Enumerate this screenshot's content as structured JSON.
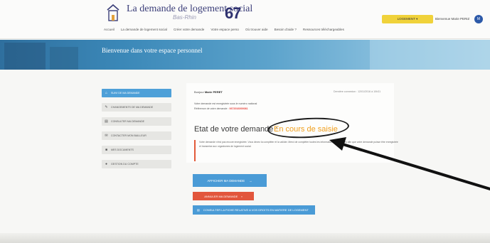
{
  "header": {
    "site_title": "La demande de logement social",
    "site_subtitle": "Bas-Rhin",
    "site_number": "67",
    "nav": [
      "Accueil",
      "La demande de logement social",
      "Créer votre demande",
      "Votre espace perso",
      "Où trouver aide",
      "Besoin d'aide ?",
      "Ressources téléchargeables"
    ],
    "account_button": "LOGEMENT ▾",
    "user_name": "Bienvenue Marie PERIZ",
    "avatar_initial": "M"
  },
  "banner": {
    "title": "Bienvenue dans votre espace personnel"
  },
  "sidebar": {
    "items": [
      {
        "label": "SUIVI DE MA DEMANDE",
        "icon": "home-icon"
      },
      {
        "label": "CHANGEMENTS DE MA DEMANDE",
        "icon": "edit-icon"
      },
      {
        "label": "CONSULTER MA DEMANDE",
        "icon": "document-icon"
      },
      {
        "label": "CONTACTER MON BAILLEUR",
        "icon": "mail-icon"
      },
      {
        "label": "MES DOCUMENTS",
        "icon": "folder-icon"
      },
      {
        "label": "GESTION DU COMPTE",
        "icon": "user-icon"
      }
    ]
  },
  "main": {
    "greeting_prefix": "Bonjour",
    "greeting_name": "Marie PERET",
    "date": "Dernière connexion : 12/01/2016 à 10h31",
    "ref_line": "Votre demande est enregistrée sous le numéro national",
    "num_prefix": "Référence de votre demande :",
    "num_value": "0672016000081",
    "state_label": "Etat de votre demande :",
    "state_value": "En cours de saisie",
    "notice": "Votre demande n'est pas encore enregistrée. Vous devez la compléter et la valider. Merci de compléter toutes les informations demandées afin que votre demande puisse être enregistrée et transmise aux organismes de logement social."
  },
  "buttons": {
    "continue": "AFFICHER MA DEMANDE",
    "cancel": "ANNULER MA DEMANDE",
    "wide": "CONSULTER LA FICHE RELATIVE A VOS DROITS EN MATIERE DE LOGEMENT"
  },
  "colors": {
    "brand_blue": "#4a9bd6",
    "accent_orange": "#f0a020",
    "danger_red": "#e2563c",
    "account_yellow": "#f0d23a"
  }
}
